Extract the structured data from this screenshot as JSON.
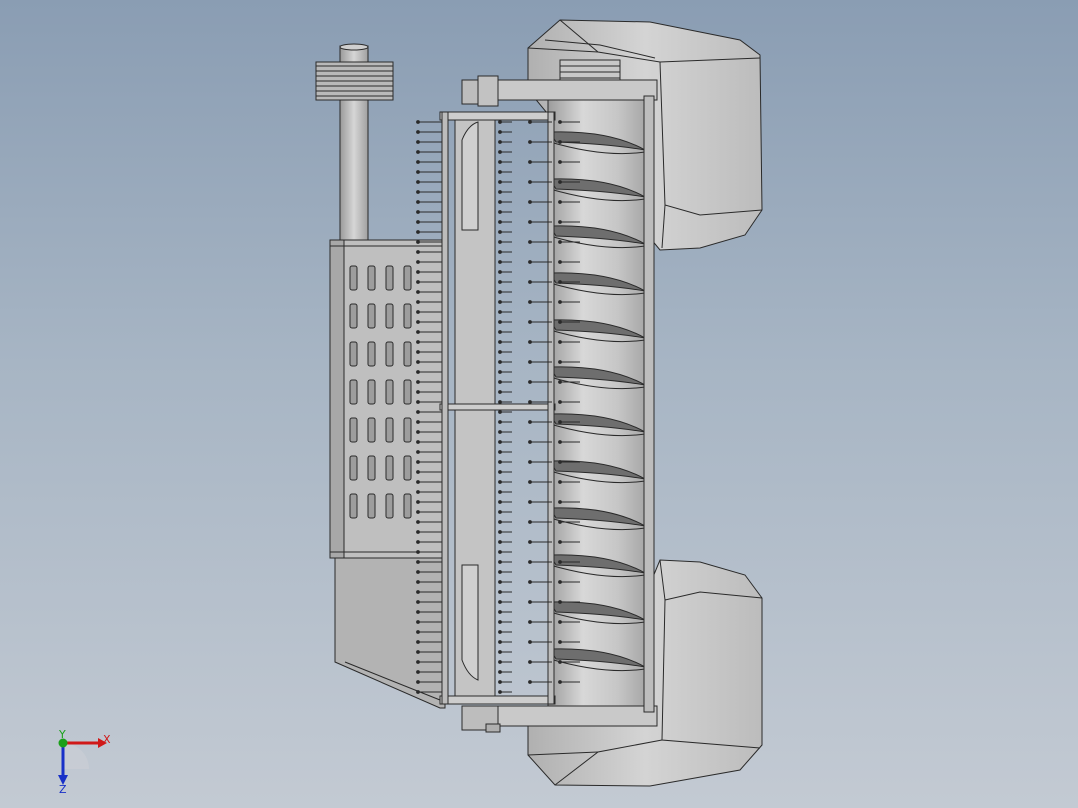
{
  "axes": {
    "x_label": "X",
    "y_label": "Y",
    "z_label": "Z",
    "x_color": "#d01818",
    "y_color": "#1aa01a",
    "z_color": "#1830c8"
  },
  "colors": {
    "background_top": "#8a9db3",
    "background_bottom": "#c3cad3",
    "part_light": "#d2d2d2",
    "part_mid": "#b8b8b8",
    "part_dark": "#8c8c8c",
    "edge": "#2a2a2a"
  },
  "icons": {
    "triad": "view-orientation-triad-icon"
  }
}
